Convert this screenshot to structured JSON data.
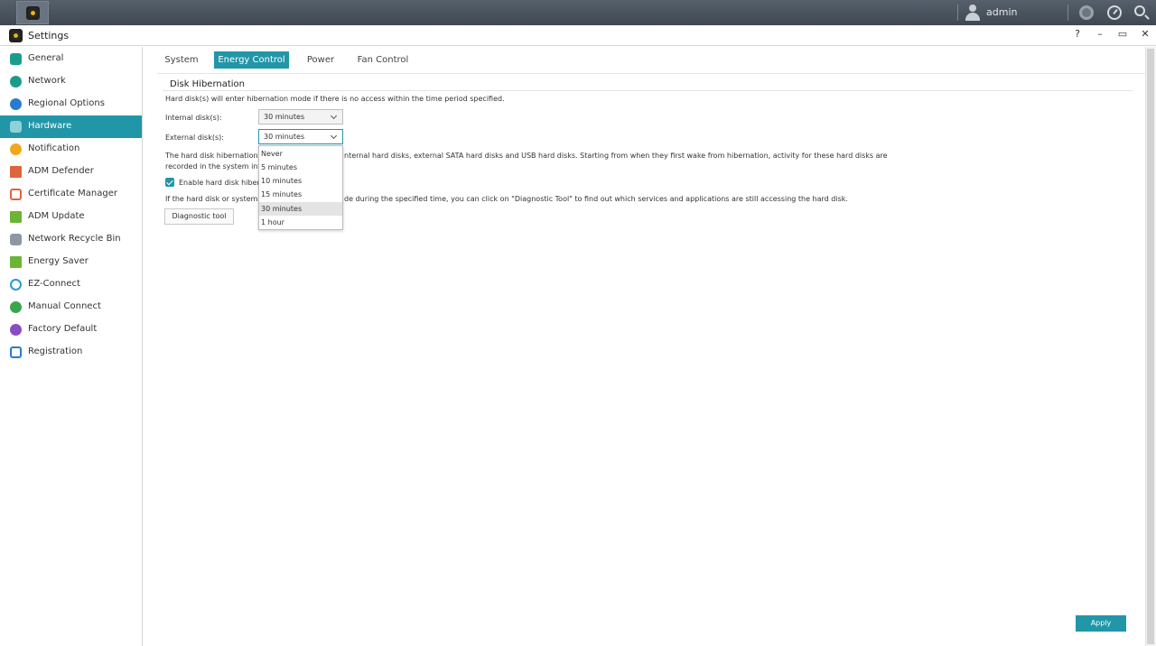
{
  "topbar": {
    "user": "admin"
  },
  "window": {
    "title": "Settings",
    "controls": [
      "?",
      "–",
      "▭",
      "✕"
    ]
  },
  "sidebar": {
    "items": [
      {
        "label": "General",
        "icon": "general-icon",
        "color": "#1a9c8c"
      },
      {
        "label": "Network",
        "icon": "network-icon",
        "color": "#1a9c8c"
      },
      {
        "label": "Regional Options",
        "icon": "regional-options-icon",
        "color": "#2a7bd0"
      },
      {
        "label": "Hardware",
        "icon": "hardware-icon",
        "color": "#8fd0da",
        "active": true
      },
      {
        "label": "Notification",
        "icon": "notification-icon",
        "color": "#f0a81c"
      },
      {
        "label": "ADM Defender",
        "icon": "adm-defender-icon",
        "color": "#e0643c"
      },
      {
        "label": "Certificate Manager",
        "icon": "certificate-manager-icon",
        "color": "#e0643c"
      },
      {
        "label": "ADM Update",
        "icon": "adm-update-icon",
        "color": "#6bb536"
      },
      {
        "label": "Network Recycle Bin",
        "icon": "recycle-bin-icon",
        "color": "#8a98a8"
      },
      {
        "label": "Energy Saver",
        "icon": "energy-saver-icon",
        "color": "#6bb536"
      },
      {
        "label": "EZ-Connect",
        "icon": "ez-connect-icon",
        "color": "#2a9ad0"
      },
      {
        "label": "Manual Connect",
        "icon": "manual-connect-icon",
        "color": "#3aa64c"
      },
      {
        "label": "Factory Default",
        "icon": "factory-default-icon",
        "color": "#8a4cc0"
      },
      {
        "label": "Registration",
        "icon": "registration-icon",
        "color": "#2a7bd0"
      }
    ]
  },
  "tabs": [
    "System",
    "Energy Control",
    "Power",
    "Fan Control"
  ],
  "active_tab": "Energy Control",
  "section": {
    "title": "Disk Hibernation",
    "intro": "Hard disk(s) will enter hibernation mode if there is no access within the time period specified.",
    "internal_label": "Internal disk(s):",
    "internal_value": "30 minutes",
    "external_label": "External disk(s):",
    "external_value": "30 minutes",
    "desc_line1_part1": "The hard disk hibernation lo",
    "desc_line1_part2": "nternal hard disks, external SATA hard disks and USB hard disks. Starting from when they first wake from hibernation, activity for these hard disks are",
    "desc_line2_part1": "recorded in the system infor",
    "enable_label": "Enable hard disk hiberna",
    "note_part1": "If the hard disk or system ha",
    "note_part2": "de during the specified time, you can click on \"Diagnostic Tool\" to find out which services and applications are still accessing the hard disk.",
    "diagnostic_button": "Diagnostic tool"
  },
  "dropdown": {
    "options": [
      "Never",
      "5 minutes",
      "10 minutes",
      "15 minutes",
      "30 minutes",
      "1 hour"
    ],
    "selected": "30 minutes"
  },
  "footer": {
    "apply": "Apply"
  },
  "colors": {
    "accent": "#2196a7"
  }
}
